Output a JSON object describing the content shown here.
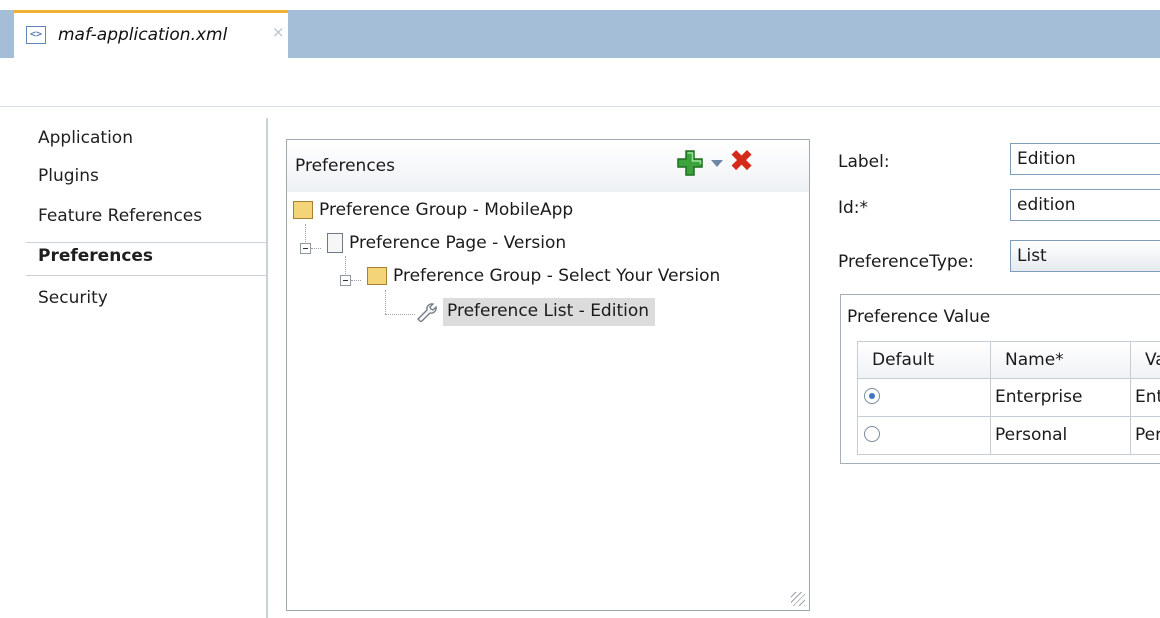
{
  "editor_tab": {
    "title": "maf-application.xml",
    "close": "×"
  },
  "nav": {
    "items": [
      {
        "label": "Application",
        "active": false
      },
      {
        "label": "Plugins",
        "active": false
      },
      {
        "label": "Feature References",
        "active": false
      },
      {
        "label": "Preferences",
        "active": true
      },
      {
        "label": "Security",
        "active": false
      }
    ]
  },
  "tree_panel": {
    "title": "Preferences",
    "add_icon": "green-plus-icon",
    "delete_icon": "red-x-icon",
    "nodes": [
      {
        "label": "Preference Group - MobileApp",
        "icon": "folder-icon",
        "selected": false
      },
      {
        "label": "Preference Page - Version",
        "icon": "page-icon",
        "selected": false
      },
      {
        "label": "Preference Group - Select Your Version",
        "icon": "folder-icon",
        "selected": false
      },
      {
        "label": "Preference List - Edition",
        "icon": "wrench-icon",
        "selected": true
      }
    ]
  },
  "form": {
    "label_label": "Label:",
    "label_value": "Edition",
    "id_label": "Id:*",
    "id_value": "edition",
    "type_label": "PreferenceType:",
    "type_value": "List"
  },
  "preference_value": {
    "title": "Preference Value",
    "columns": [
      "Default",
      "Name*",
      "Va"
    ],
    "rows": [
      {
        "default": true,
        "name": "Enterprise",
        "value": "Ent"
      },
      {
        "default": false,
        "name": "Personal",
        "value": "Per"
      }
    ]
  },
  "colors": {
    "tab_accent": "#f2b133",
    "tab_strip": "#a5bed7",
    "delete": "#d42a19",
    "add": "#3ca33c"
  }
}
